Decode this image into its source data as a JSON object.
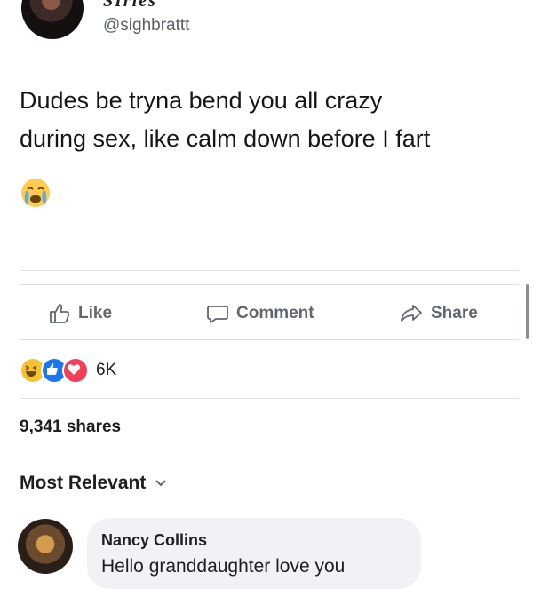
{
  "post": {
    "author_name_partial": "SIrles",
    "handle": "@sighbrattt",
    "text_line1": "Dudes be tryna bend you all crazy",
    "text_line2": "during sex, like calm down before I fart",
    "emoji": "crying-face-icon"
  },
  "actions": {
    "like_label": "Like",
    "comment_label": "Comment",
    "share_label": "Share"
  },
  "reactions": {
    "icons": [
      "haha-reaction-icon",
      "like-reaction-icon",
      "love-reaction-icon"
    ],
    "count": "6K"
  },
  "shares": {
    "text": "9,341 shares"
  },
  "comments_sort": {
    "label": "Most Relevant"
  },
  "comment": {
    "author": "Nancy Collins",
    "text": "Hello granddaughter love you"
  },
  "colors": {
    "action_gray": "#606770",
    "like_blue": "#1877f2",
    "love_red": "#f33e58",
    "haha_yellow": "#f7c132",
    "bubble_gray": "#f0f2f5"
  }
}
